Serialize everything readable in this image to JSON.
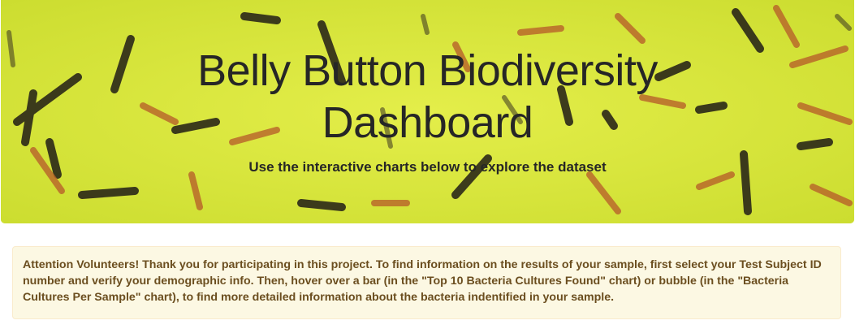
{
  "hero": {
    "title_line1": "Belly Button Biodiversity",
    "title_line2": "Dashboard",
    "subtitle": "Use the interactive charts below to explore the dataset",
    "background_color": "#d8e83a",
    "rod_colors": [
      "#2b2818",
      "#b8622a",
      "#3a3320"
    ]
  },
  "alert": {
    "lead": "Attention Volunteers!",
    "message": " Thank you for participating in this project. To find information on the results of your sample, first select your Test Subject ID number and verify your demographic info. Then, hover over a bar (in the \"Top 10 Bacteria Cultures Found\" chart) or bubble (in the \"Bacteria Cultures Per Sample\" chart), to find more detailed information about the bacteria indentified in your sample.",
    "background_color": "#fcf8e3",
    "border_color": "#faebcc",
    "text_color": "#8a6d3b"
  }
}
